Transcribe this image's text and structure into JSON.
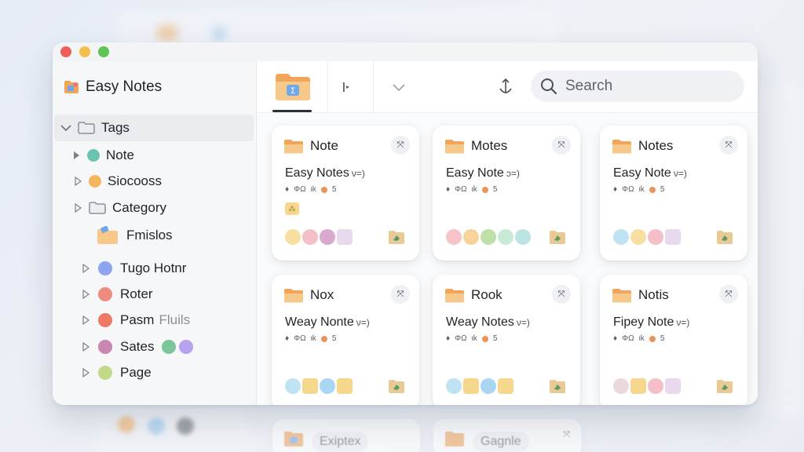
{
  "colors": {
    "folder_orange": "#f0a55a",
    "folder_light": "#f6c889",
    "folder_badge": "#6fa7e8",
    "accent_dark": "#2b2f36",
    "traffic_red": "#ee5f57",
    "traffic_yellow": "#f5bf4f",
    "traffic_green": "#5fc454"
  },
  "app": {
    "title": "Easy Notes"
  },
  "sidebar": {
    "tags_header": "Tags",
    "items": [
      {
        "label": "Note",
        "color": "#6cc3b0",
        "kind": "dot"
      },
      {
        "label": "Siocooss",
        "color": "#f5b55c",
        "kind": "dot"
      },
      {
        "label": "Category",
        "kind": "folder"
      },
      {
        "label": "Fmislos",
        "kind": "folder-filled"
      },
      {
        "label": "Tugo Hotnr",
        "color": "#8ea4f2",
        "kind": "dot"
      },
      {
        "label": "Roter",
        "color": "#ef8c7d",
        "kind": "dot"
      },
      {
        "label": "Pasm",
        "label_extra": "Fluils",
        "color": "#ee7a66",
        "kind": "dot"
      },
      {
        "label": "Sates",
        "color": "#c886b0",
        "kind": "dot",
        "extra_dots": [
          "#7cc49a",
          "#b7a2ef"
        ]
      },
      {
        "label": "Page",
        "color": "#c3d98a",
        "kind": "dot"
      }
    ]
  },
  "toolbar": {
    "search_placeholder": "Search",
    "icons": [
      "folder-badge-icon",
      "play-step-icon",
      "chevron-down-icon",
      "anchor-icon",
      "search-icon"
    ]
  },
  "cards": [
    {
      "folder": "Note",
      "title": "Easy Notes",
      "suffix": "ν=)",
      "meta": [
        "♦",
        "ΦΩ",
        "ιk",
        "5"
      ],
      "sticker": true,
      "chips": [
        "#f6dfa0",
        "#f4bfc8",
        "#d8a8cf",
        "#e9d9ee"
      ]
    },
    {
      "folder": "Motes",
      "title": "Easy Note",
      "suffix": "ↄ=)",
      "meta": [
        "♦",
        "ΦΩ",
        "ιk",
        "5"
      ],
      "sticker": false,
      "chips": [
        "#f6c3c8",
        "#f7d39a",
        "#bfe0a6",
        "#c9ead7",
        "#bde4e2"
      ]
    },
    {
      "folder": "Notes",
      "title": "Easy Note",
      "suffix": "ν=)",
      "meta": [
        "♦",
        "ΦΩ",
        "ιk",
        "5"
      ],
      "sticker": false,
      "chips": [
        "#bfe3f2",
        "#f6dfa0",
        "#f4bfc8",
        "#e9d9ee"
      ]
    },
    {
      "folder": "Nox",
      "title": "Weay Nonte",
      "suffix": "ν=)",
      "meta": [
        "♦",
        "ΦΩ",
        "ιk",
        "5"
      ],
      "sticker": false,
      "chips": [
        "#bfe3f2",
        "#f5d78e",
        "#a9d6f2",
        "#f5d78e"
      ]
    },
    {
      "folder": "Rook",
      "title": "Weay Notes",
      "suffix": "ν=)",
      "meta": [
        "♦",
        "ΦΩ",
        "ιk",
        "5"
      ],
      "sticker": false,
      "chips": [
        "#bfe3f2",
        "#f5d78e",
        "#a9d6f2",
        "#f5d78e"
      ]
    },
    {
      "folder": "Notis",
      "title": "Fipey Note",
      "suffix": "ν=)",
      "meta": [
        "♦",
        "ΦΩ",
        "ιk",
        "5"
      ],
      "sticker": false,
      "chips": [
        "#ead9dc",
        "#f5d78e",
        "#f4bfc8",
        "#e9d9ee"
      ]
    }
  ],
  "ghost_cards": [
    {
      "label": "Exiptex"
    },
    {
      "label": "Gagnle"
    }
  ]
}
